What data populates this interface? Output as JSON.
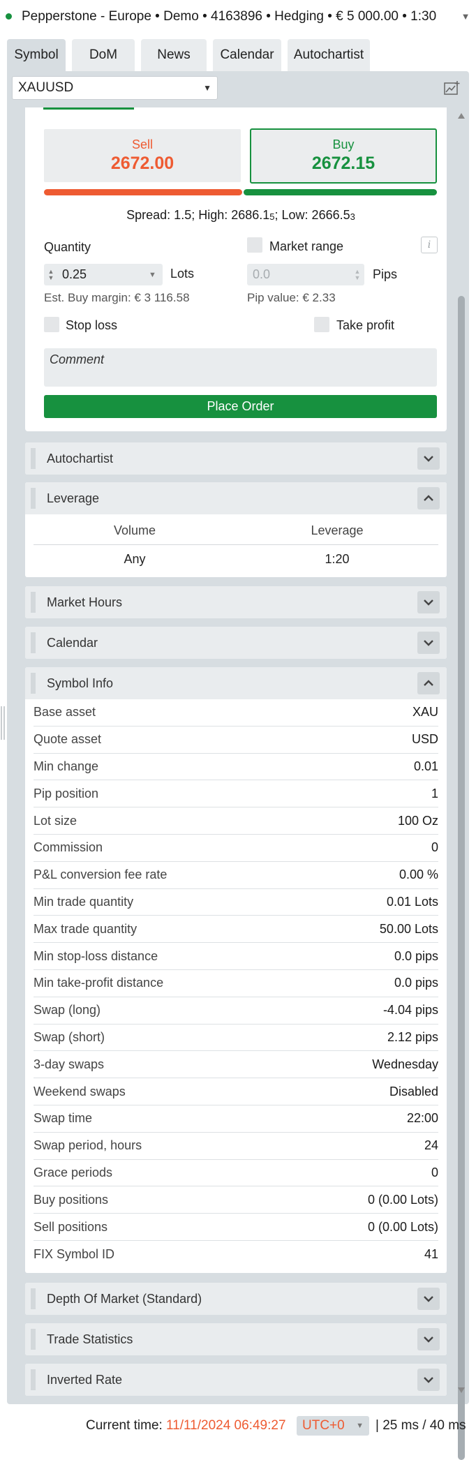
{
  "account": {
    "title": "Pepperstone - Europe • Demo • 4163896 • Hedging • € 5 000.00 • 1:30",
    "status_color": "#17913f"
  },
  "tabs": [
    {
      "label": "Symbol",
      "active": true
    },
    {
      "label": "DoM",
      "active": false
    },
    {
      "label": "News",
      "active": false
    },
    {
      "label": "Calendar",
      "active": false
    },
    {
      "label": "Autochartist",
      "active": false
    }
  ],
  "symbol": {
    "selected": "XAUUSD"
  },
  "order": {
    "sell_label": "Sell",
    "sell_price": "2672.00",
    "buy_label": "Buy",
    "buy_price": "2672.15",
    "spread_prefix": "Spread: 1.5; High: 2686.1",
    "high_pip": "5",
    "low_prefix": "; Low: 2666.5",
    "low_pip": "3",
    "quantity_label": "Quantity",
    "quantity_value": "0.25",
    "lots_label": "Lots",
    "market_range_label": "Market range",
    "info_glyph": "i",
    "pips_value": "0.0",
    "pips_label": "Pips",
    "margin_text": "Est. Buy margin: € 3 116.58",
    "pip_value_text": "Pip value: € 2.33",
    "stop_loss_label": "Stop loss",
    "take_profit_label": "Take profit",
    "comment_placeholder": "Comment",
    "place_order_label": "Place Order",
    "sell_color": "#ee5b32",
    "buy_color": "#17913f"
  },
  "sections": {
    "autochartist": "Autochartist",
    "leverage": "Leverage",
    "market_hours": "Market Hours",
    "calendar": "Calendar",
    "symbol_info": "Symbol Info",
    "depth_of_market": "Depth Of Market (Standard)",
    "trade_statistics": "Trade Statistics",
    "inverted_rate": "Inverted Rate"
  },
  "leverage_table": {
    "headers": [
      "Volume",
      "Leverage"
    ],
    "rows": [
      [
        "Any",
        "1:20"
      ]
    ]
  },
  "symbol_info": [
    {
      "k": "Base asset",
      "v": "XAU"
    },
    {
      "k": "Quote asset",
      "v": "USD"
    },
    {
      "k": "Min change",
      "v": "0.01"
    },
    {
      "k": "Pip position",
      "v": "1"
    },
    {
      "k": "Lot size",
      "v": "100 Oz"
    },
    {
      "k": "Commission",
      "v": "0"
    },
    {
      "k": "P&L conversion fee rate",
      "v": "0.00 %"
    },
    {
      "k": "Min trade quantity",
      "v": "0.01 Lots"
    },
    {
      "k": "Max trade quantity",
      "v": "50.00 Lots"
    },
    {
      "k": "Min stop-loss distance",
      "v": "0.0 pips"
    },
    {
      "k": "Min take-profit distance",
      "v": "0.0 pips"
    },
    {
      "k": "Swap (long)",
      "v": "-4.04 pips"
    },
    {
      "k": "Swap (short)",
      "v": "2.12 pips"
    },
    {
      "k": "3-day swaps",
      "v": "Wednesday"
    },
    {
      "k": "Weekend swaps",
      "v": "Disabled"
    },
    {
      "k": "Swap time",
      "v": "22:00"
    },
    {
      "k": "Swap period, hours",
      "v": "24"
    },
    {
      "k": "Grace periods",
      "v": "0"
    },
    {
      "k": "Buy positions",
      "v": "0 (0.00 Lots)"
    },
    {
      "k": "Sell positions",
      "v": "0 (0.00 Lots)"
    },
    {
      "k": "FIX Symbol ID",
      "v": "41"
    }
  ],
  "status": {
    "current_time_label": "Current time:",
    "current_time": "11/11/2024 06:49:27",
    "timezone": "UTC+0",
    "latency": "| 25 ms / 40 ms"
  }
}
